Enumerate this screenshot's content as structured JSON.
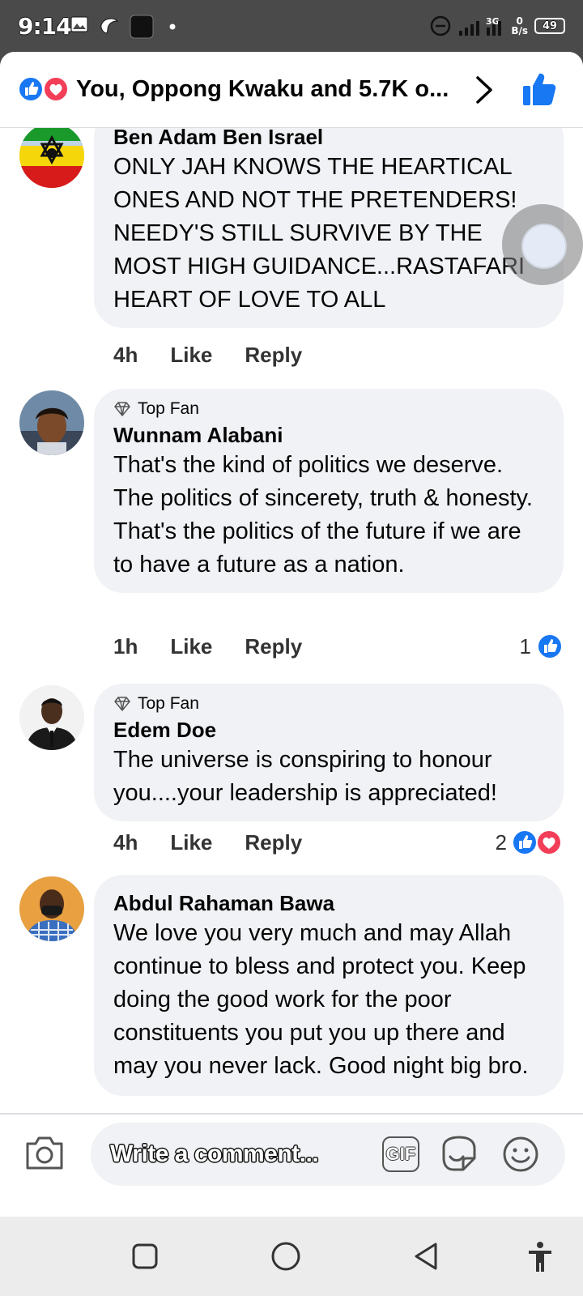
{
  "status_bar": {
    "time": "9:14",
    "signal": "3G",
    "net_speed_value": "0",
    "net_speed_unit": "B/s",
    "battery": "49"
  },
  "header": {
    "title": "You, Oppong Kwaku and 5.7K o...",
    "reaction_icons": [
      "like-icon",
      "love-icon"
    ]
  },
  "comments": [
    {
      "author": "Ben Adam Ben Israel",
      "top_fan": false,
      "text": "ONLY JAH KNOWS THE HEARTICAL ONES AND NOT THE PRETENDERS! NEEDY'S STILL SURVIVE BY THE MOST HIGH GUIDANCE...RASTAFARI HEART OF LOVE TO ALL",
      "time": "4h",
      "like_label": "Like",
      "reply_label": "Reply",
      "reaction_count": ""
    },
    {
      "author": "Wunnam Alabani",
      "top_fan": true,
      "top_fan_label": "Top Fan",
      "text": "That's the kind of politics we deserve. The politics of sincerety, truth & honesty. That's the politics of the future if we are to have a future as a nation.",
      "time": "1h",
      "like_label": "Like",
      "reply_label": "Reply",
      "reaction_count": "1"
    },
    {
      "author": "Edem Doe",
      "top_fan": true,
      "top_fan_label": "Top Fan",
      "text": "The universe is conspiring to honour you....your leadership is appreciated!",
      "time": "4h",
      "like_label": "Like",
      "reply_label": "Reply",
      "reaction_count": "2"
    },
    {
      "author": "Abdul Rahaman Bawa",
      "top_fan": false,
      "text": "We love you very much and may Allah continue to bless and protect you. Keep doing the good work for the poor constituents you put you up there and may you never lack. Good night big bro."
    }
  ],
  "composer": {
    "placeholder": "Write a comment...",
    "gif_label": "GIF"
  },
  "colors": {
    "facebook_blue": "#1877f2",
    "love_red": "#f33e58",
    "bubble_bg": "#f0f2f5"
  }
}
